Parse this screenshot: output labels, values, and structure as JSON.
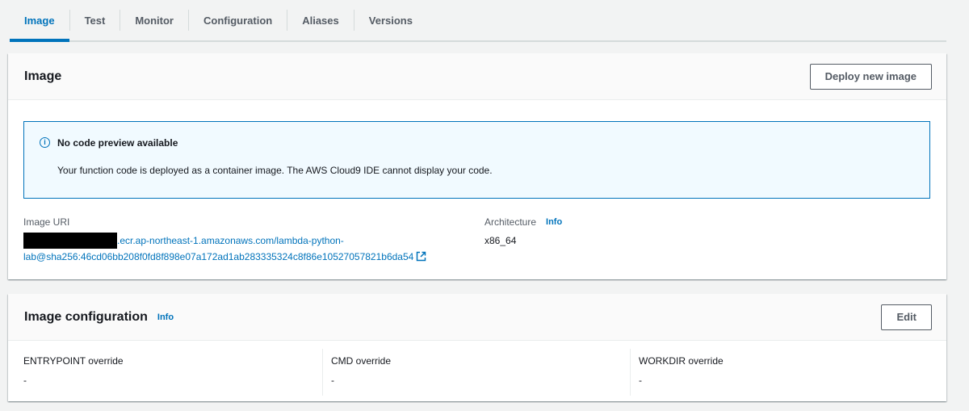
{
  "tabs": [
    {
      "label": "Image",
      "active": true
    },
    {
      "label": "Test"
    },
    {
      "label": "Monitor"
    },
    {
      "label": "Configuration"
    },
    {
      "label": "Aliases"
    },
    {
      "label": "Versions"
    }
  ],
  "image_panel": {
    "title": "Image",
    "deploy_button": "Deploy new image",
    "alert": {
      "title": "No code preview available",
      "body": "Your function code is deployed as a container image. The AWS Cloud9 IDE cannot display your code.",
      "icon": "info-icon"
    },
    "image_uri": {
      "label": "Image URI",
      "value_line1": ".ecr.ap-northeast-1.amazonaws.com/lambda-python-",
      "value_line2": "lab@sha256:46cd06bb208f0fd8f898e07a172ad1ab283335324c8f86e10527057821b6da54"
    },
    "architecture": {
      "label": "Architecture",
      "info": "Info",
      "value": "x86_64"
    }
  },
  "config_panel": {
    "title": "Image configuration",
    "info": "Info",
    "edit_button": "Edit",
    "fields": [
      {
        "label": "ENTRYPOINT override",
        "value": "-"
      },
      {
        "label": "CMD override",
        "value": "-"
      },
      {
        "label": "WORKDIR override",
        "value": "-"
      }
    ]
  },
  "colors": {
    "accent": "#0073bb",
    "background": "#f2f3f3",
    "alert_bg": "#f1faff"
  }
}
